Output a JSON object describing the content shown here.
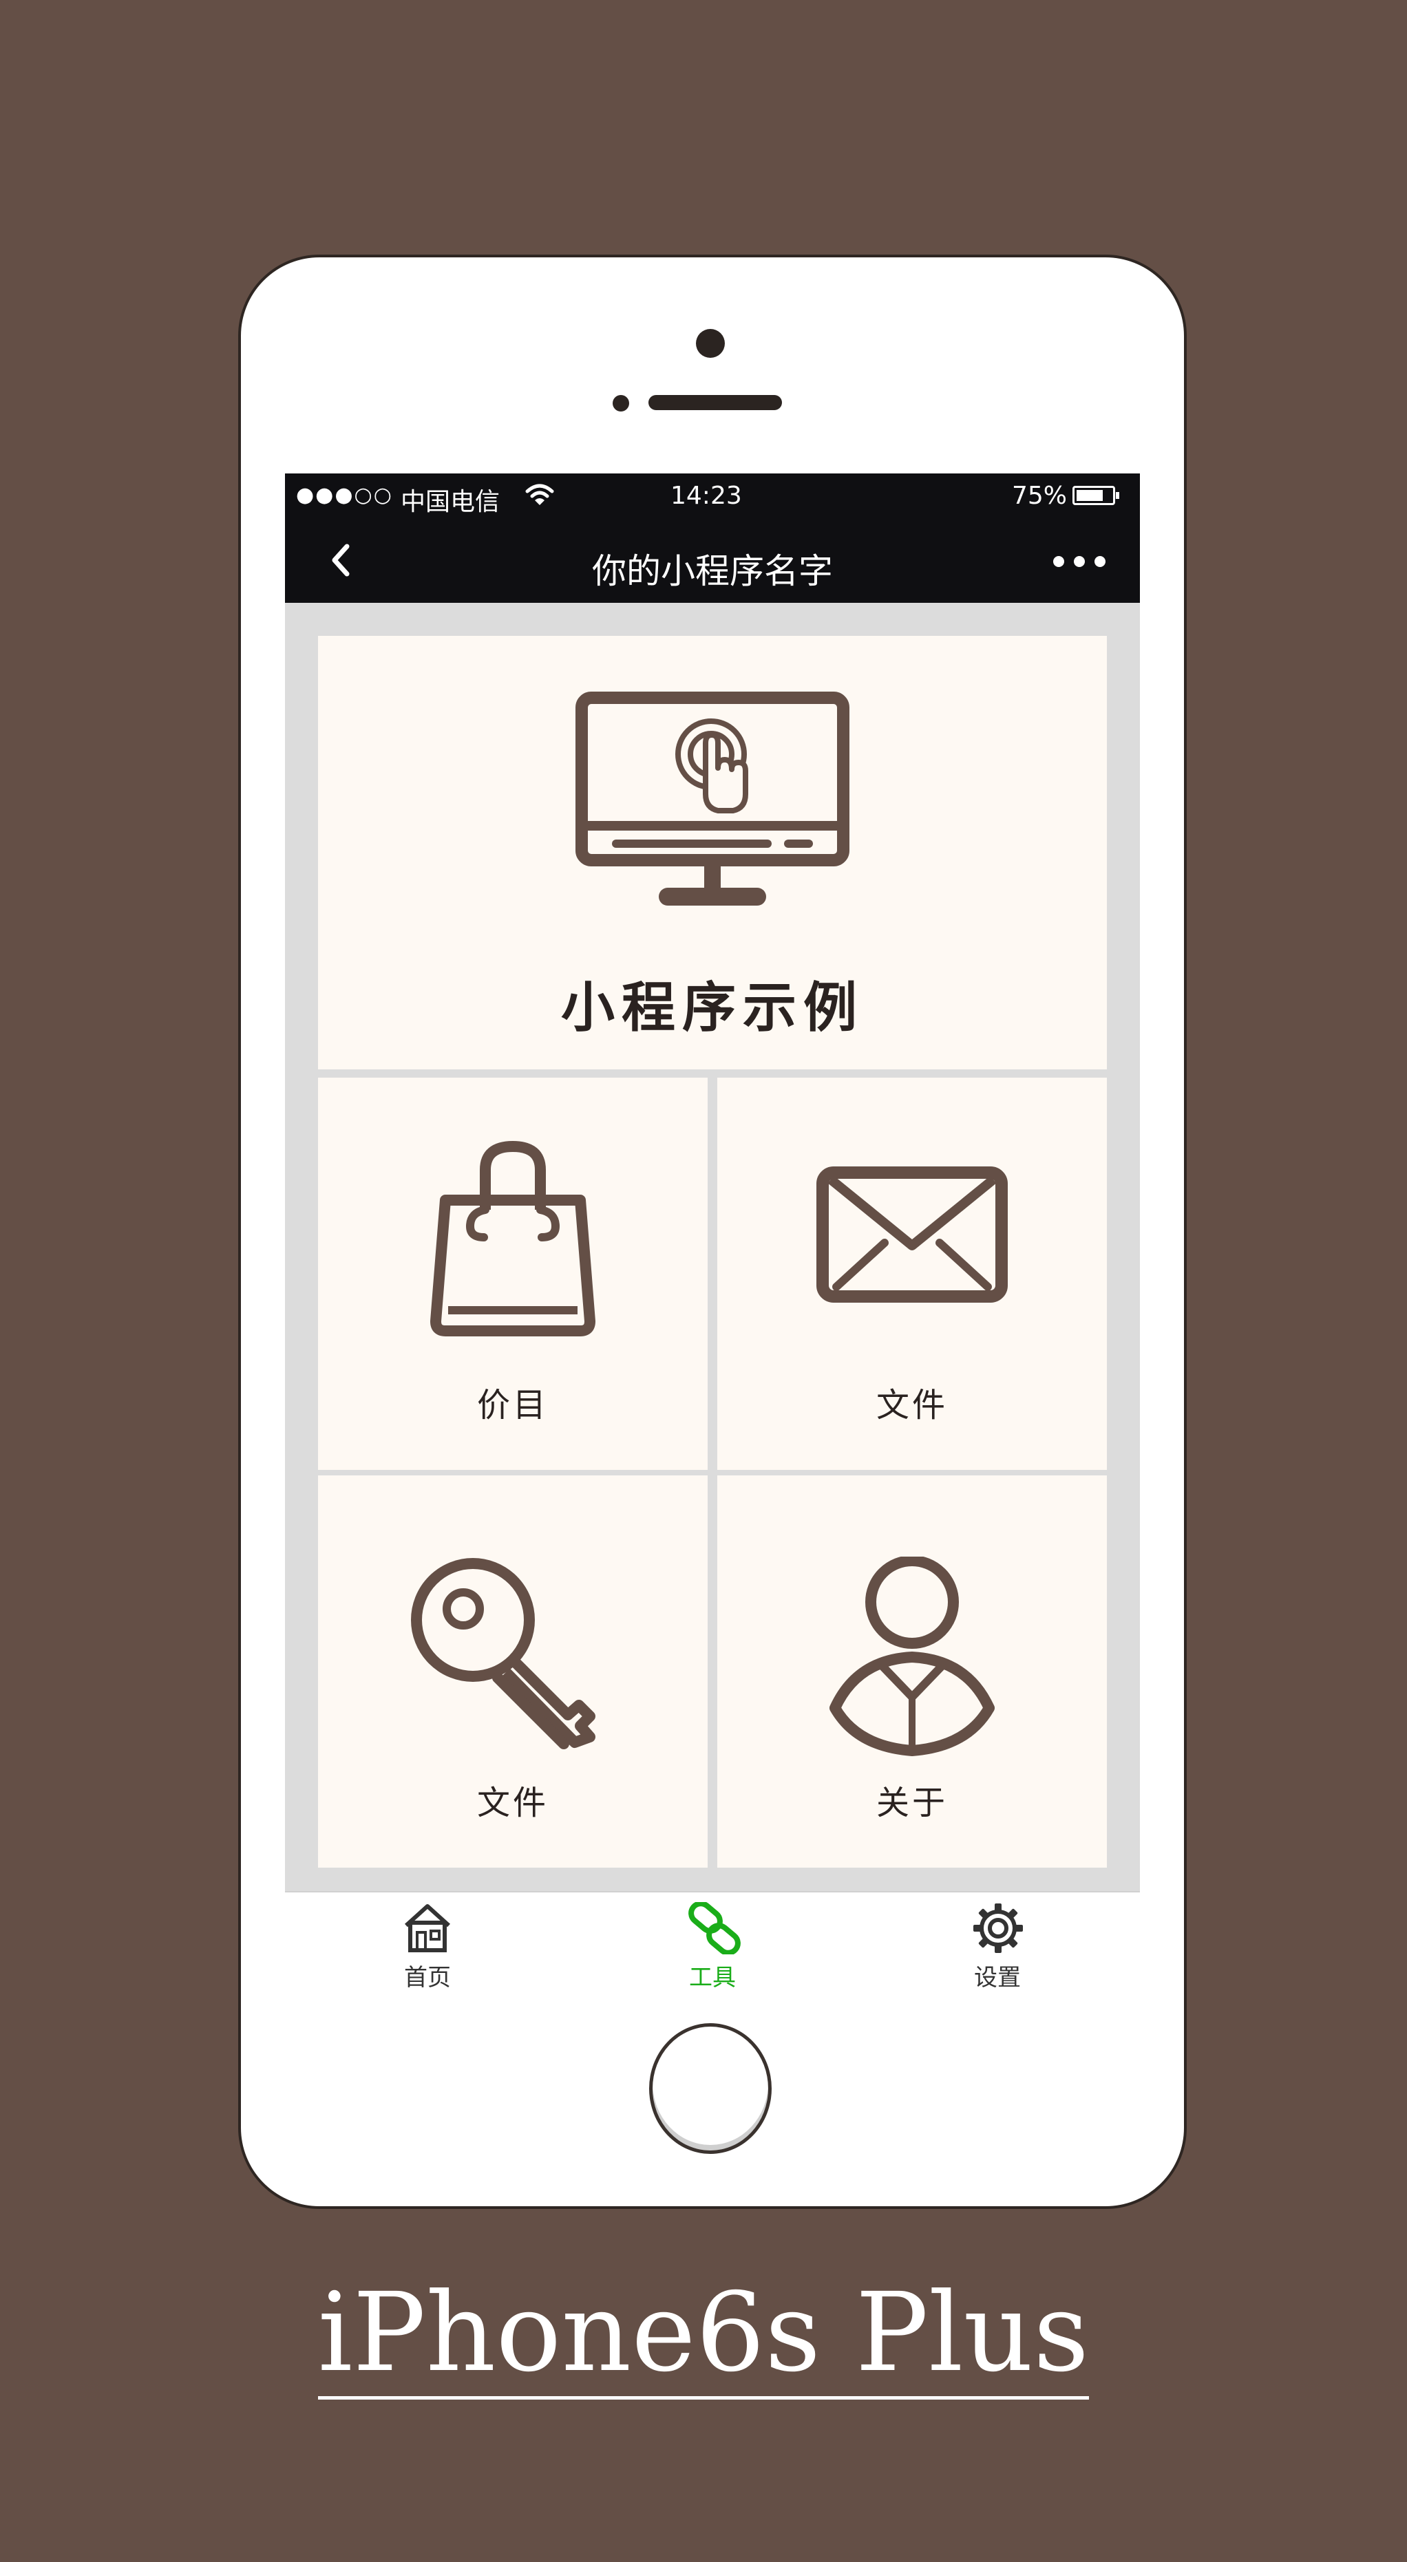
{
  "status_bar": {
    "signal": "●●●○○",
    "carrier": "中国电信",
    "time": "14:23",
    "battery_text": "75%",
    "battery_level": 0.75
  },
  "nav_bar": {
    "title": "你的小程序名字"
  },
  "hero": {
    "label": "小程序示例",
    "icon": "monitor-touch-icon"
  },
  "tiles": [
    {
      "label": "价目",
      "icon": "shopping-bag-icon"
    },
    {
      "label": "文件",
      "icon": "envelope-icon"
    },
    {
      "label": "文件",
      "icon": "key-icon"
    },
    {
      "label": "关于",
      "icon": "user-icon"
    }
  ],
  "tab_bar": {
    "tabs": [
      {
        "label": "首页",
        "icon": "home-icon",
        "active": false
      },
      {
        "label": "工具",
        "icon": "link-icon",
        "active": true
      },
      {
        "label": "设置",
        "icon": "gear-icon",
        "active": false
      }
    ],
    "active_color": "#1aad19",
    "inactive_color": "#333333"
  },
  "colors": {
    "background": "#644f46",
    "icon": "#644f46",
    "tile": "#fef9f3",
    "nav": "#0f0f12"
  },
  "model_label": "iPhone6s Plus"
}
